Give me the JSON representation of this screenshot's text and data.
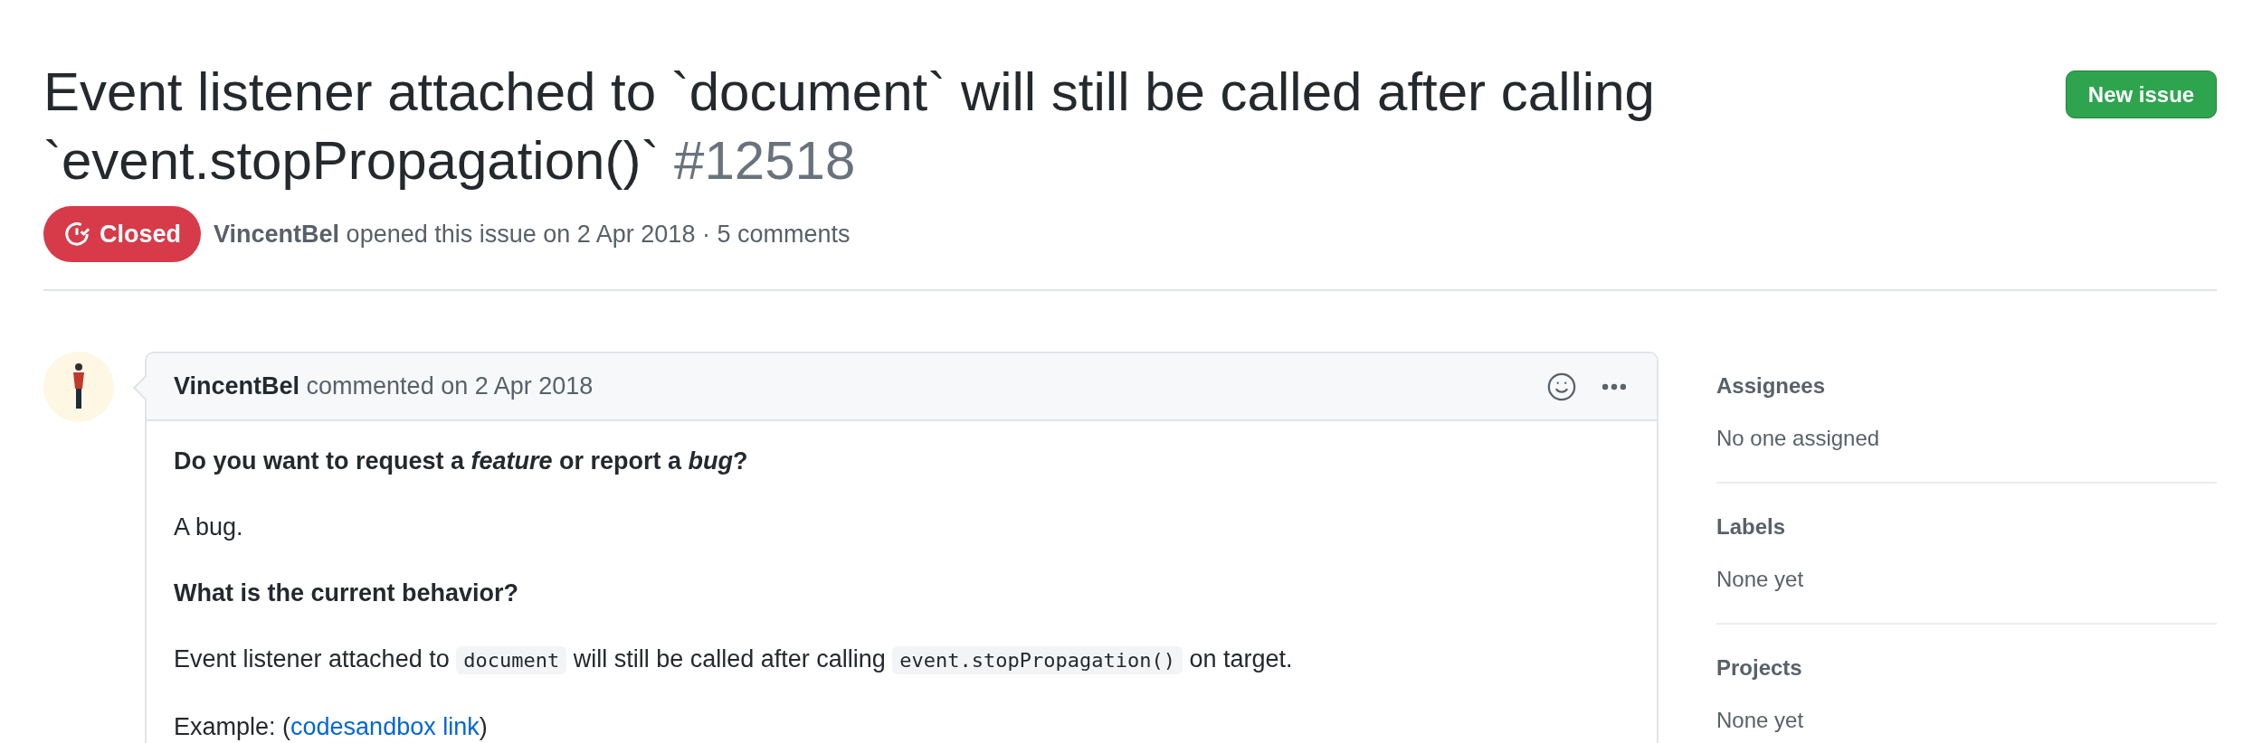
{
  "issue": {
    "title": "Event listener attached to `document` will still be called after calling `event.stopPropagation()`",
    "number": "#12518",
    "open": false,
    "state_label": "Closed",
    "author": "VincentBel",
    "meta": "opened this issue on 2 Apr 2018 · 5 comments"
  },
  "new_issue_button": "New issue",
  "comment": {
    "author": "VincentBel",
    "meta": "commented on 2 Apr 2018",
    "body": [
      {
        "kind": "heading",
        "parts": [
          {
            "kind": "text",
            "text": "Do you want to request a *feature* or report a *bug*?"
          }
        ]
      },
      {
        "kind": "paragraph",
        "parts": [
          {
            "kind": "text",
            "text": "A bug."
          }
        ]
      },
      {
        "kind": "heading",
        "parts": [
          {
            "kind": "text",
            "text": "What is the current behavior?"
          }
        ]
      },
      {
        "kind": "paragraph",
        "parts": [
          {
            "kind": "text",
            "text": "Event listener attached to "
          },
          {
            "kind": "code",
            "text": "document"
          },
          {
            "kind": "text",
            "text": " will still be called after calling "
          },
          {
            "kind": "code",
            "text": "event.stopPropagation()"
          },
          {
            "kind": "text",
            "text": " on target."
          }
        ]
      },
      {
        "kind": "paragraph",
        "parts": [
          {
            "kind": "text",
            "text": "Example: ("
          },
          {
            "kind": "link",
            "text": "codesandbox link"
          },
          {
            "kind": "text",
            "text": ")"
          }
        ]
      }
    ]
  },
  "sidebar": [
    {
      "heading": "Assignees",
      "value": "No one assigned"
    },
    {
      "heading": "Labels",
      "value": "None yet"
    },
    {
      "heading": "Projects",
      "value": "None yet"
    }
  ]
}
